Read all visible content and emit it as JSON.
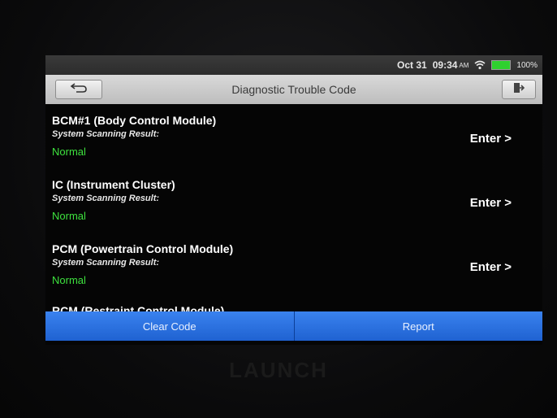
{
  "statusbar": {
    "date": "Oct 31",
    "time": "09:34",
    "ampm": "AM",
    "battery": "100%"
  },
  "header": {
    "title": "Diagnostic Trouble Code"
  },
  "modules": [
    {
      "name": "BCM#1 (Body Control Module)",
      "result_label": "System Scanning Result:",
      "status": "Normal",
      "action": "Enter >"
    },
    {
      "name": "IC (Instrument Cluster)",
      "result_label": "System Scanning Result:",
      "status": "Normal",
      "action": "Enter >"
    },
    {
      "name": "PCM (Powertrain Control Module)",
      "result_label": "System Scanning Result:",
      "status": "Normal",
      "action": "Enter >"
    }
  ],
  "partial_item": "RCM (Restraint Control Module)",
  "buttons": {
    "clear": "Clear Code",
    "report": "Report"
  },
  "device_logo": "LAUNCH",
  "colors": {
    "accent_blue": "#2a72e6",
    "status_green": "#3ee23e",
    "battery_green": "#2fd12f"
  },
  "icons": [
    "back-arrow-icon",
    "exit-icon",
    "wifi-icon",
    "battery-icon"
  ]
}
